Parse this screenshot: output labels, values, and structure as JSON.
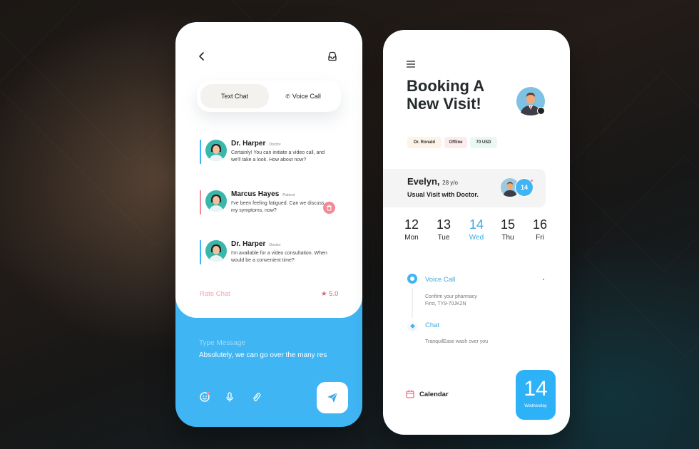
{
  "chat_screen": {
    "tabs": [
      {
        "label": "Text Chat",
        "active": true
      },
      {
        "label": "Voice Call",
        "icon": "phone-icon",
        "active": false
      }
    ],
    "messages": [
      {
        "name": "Dr. Harper",
        "role": "Doctor",
        "text": "Certainly! You can initiate a video call, and we'll take a look. How about now?",
        "accent": "#3fb5f3"
      },
      {
        "name": "Marcus Hayes",
        "role": "Patient",
        "text": "I've been feeling fatigued. Can we discuss my symptoms, now?",
        "accent": "#f08a96"
      },
      {
        "name": "Dr. Harper",
        "role": "Doctor",
        "text": "I'm available for a video consultation. When would be a convenient time?",
        "accent": "#3fb5f3"
      }
    ],
    "rate_label": "Rate Chat",
    "rating": "★ 5.0",
    "input_label": "Type Message",
    "input_value": "Absolutely, we can go over the many res",
    "icons": [
      "back-icon",
      "inbox-icon",
      "emoji-icon",
      "microphone-icon",
      "paperclip-icon",
      "send-icon",
      "trash-icon"
    ]
  },
  "booking_screen": {
    "title": "Booking A New Visit!",
    "chips": [
      {
        "label": "Dr. Ronald",
        "bg": "#fdf4e7"
      },
      {
        "label": "Offline",
        "bg": "#fdeced"
      },
      {
        "label": "70 USD",
        "bg": "#eaf8f3"
      }
    ],
    "patient": {
      "name": "Evelyn,",
      "age": "28 y/o",
      "visit": "Usual Visit with Doctor.",
      "badge_date": "14"
    },
    "days": [
      {
        "num": "12",
        "name": "Mon",
        "selected": false
      },
      {
        "num": "13",
        "name": "Tue",
        "selected": false
      },
      {
        "num": "14",
        "name": "Wed",
        "selected": true
      },
      {
        "num": "15",
        "name": "Thu",
        "selected": false
      },
      {
        "num": "16",
        "name": "Fri",
        "selected": false
      }
    ],
    "timeline": [
      {
        "title": "Voice Call",
        "sub1": "Confirm your pharmacy",
        "sub2": "First, TY9-70JK2N"
      },
      {
        "title": "Chat",
        "sub1": "TranquilEase wash over you",
        "sub2": ""
      }
    ],
    "calendar_label": "Calendar",
    "big_date": {
      "num": "14",
      "weekday": "Wednesday"
    }
  },
  "colors": {
    "accent": "#3fb5f3",
    "pink": "#f08a96",
    "dark": "#252a2c"
  }
}
